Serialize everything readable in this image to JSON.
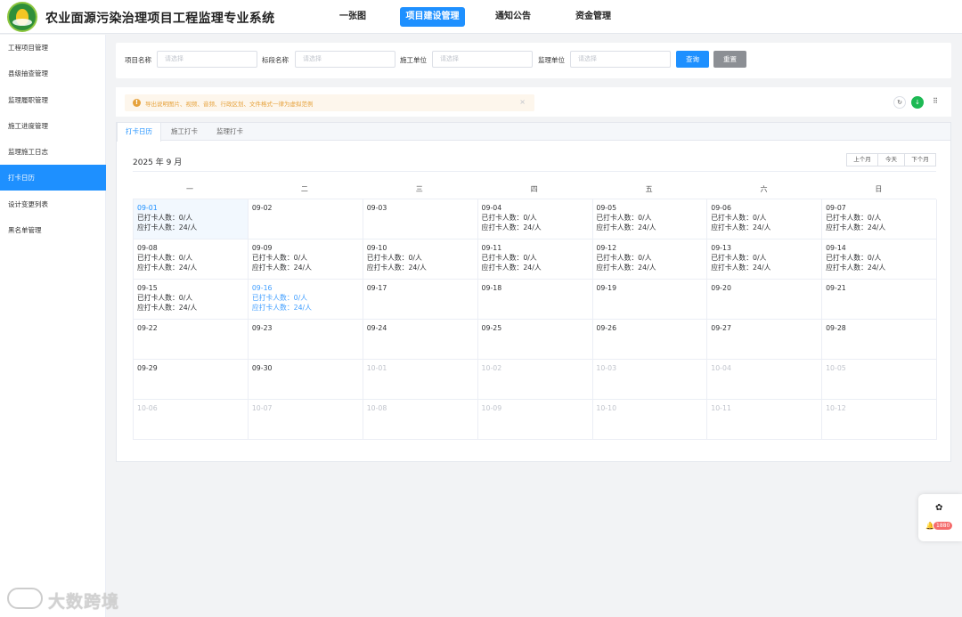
{
  "app": {
    "title": "农业面源污染治理项目工程监理专业系统"
  },
  "topnav": [
    {
      "label": "一张图",
      "active": false
    },
    {
      "label": "项目建设管理",
      "active": true
    },
    {
      "label": "通知公告",
      "active": false
    },
    {
      "label": "资金管理",
      "active": false
    }
  ],
  "sidebar": {
    "items": [
      {
        "label": "工程项目管理"
      },
      {
        "label": "县级抽查管理"
      },
      {
        "label": "监理履职管理"
      },
      {
        "label": "施工进度管理"
      },
      {
        "label": "监理施工日志"
      },
      {
        "label": "打卡日历",
        "active": true
      },
      {
        "label": "设计变更列表"
      },
      {
        "label": "黑名单管理"
      }
    ]
  },
  "filters": {
    "fields": [
      {
        "label": "项目名称",
        "placeholder": "请选择"
      },
      {
        "label": "标段名称",
        "placeholder": "请选择"
      },
      {
        "label": "施工单位",
        "placeholder": "请选择"
      },
      {
        "label": "监理单位",
        "placeholder": "请选择"
      }
    ],
    "query_label": "查询",
    "reset_label": "重置"
  },
  "alert": {
    "text": "导出说明图片、视频、音频、行政区划、文件格式一律为虚拟范例",
    "icon": "warning-icon"
  },
  "toolbar": {
    "icons": [
      "refresh-icon",
      "download-icon",
      "grid-icon"
    ]
  },
  "tabs": [
    {
      "label": "打卡日历",
      "active": true
    },
    {
      "label": "施工打卡",
      "active": false
    },
    {
      "label": "监理打卡",
      "active": false
    }
  ],
  "calendar": {
    "title": "2025 年 9 月",
    "nav": {
      "prev": "上个月",
      "today": "今天",
      "next": "下个月"
    },
    "weekdays": [
      "一",
      "二",
      "三",
      "四",
      "五",
      "六",
      "日"
    ],
    "checked_prefix": "已打卡人数：",
    "required_prefix": "应打卡人数：",
    "cells": [
      {
        "date": "09-01",
        "checked": "0/人",
        "required": "24/人",
        "state": "selected"
      },
      {
        "date": "09-02"
      },
      {
        "date": "09-03"
      },
      {
        "date": "09-04",
        "checked": "0/人",
        "required": "24/人"
      },
      {
        "date": "09-05",
        "checked": "0/人",
        "required": "24/人"
      },
      {
        "date": "09-06",
        "checked": "0/人",
        "required": "24/人"
      },
      {
        "date": "09-07",
        "checked": "0/人",
        "required": "24/人"
      },
      {
        "date": "09-08",
        "checked": "0/人",
        "required": "24/人"
      },
      {
        "date": "09-09",
        "checked": "0/人",
        "required": "24/人"
      },
      {
        "date": "09-10",
        "checked": "0/人",
        "required": "24/人"
      },
      {
        "date": "09-11",
        "checked": "0/人",
        "required": "24/人"
      },
      {
        "date": "09-12",
        "checked": "0/人",
        "required": "24/人"
      },
      {
        "date": "09-13",
        "checked": "0/人",
        "required": "24/人"
      },
      {
        "date": "09-14",
        "checked": "0/人",
        "required": "24/人"
      },
      {
        "date": "09-15",
        "checked": "0/人",
        "required": "24/人"
      },
      {
        "date": "09-16",
        "checked": "0/人",
        "required": "24/人",
        "state": "today"
      },
      {
        "date": "09-17"
      },
      {
        "date": "09-18"
      },
      {
        "date": "09-19"
      },
      {
        "date": "09-20"
      },
      {
        "date": "09-21"
      },
      {
        "date": "09-22"
      },
      {
        "date": "09-23"
      },
      {
        "date": "09-24"
      },
      {
        "date": "09-25"
      },
      {
        "date": "09-26"
      },
      {
        "date": "09-27"
      },
      {
        "date": "09-28"
      },
      {
        "date": "09-29"
      },
      {
        "date": "09-30"
      },
      {
        "date": "10-01",
        "state": "other"
      },
      {
        "date": "10-02",
        "state": "other"
      },
      {
        "date": "10-03",
        "state": "other"
      },
      {
        "date": "10-04",
        "state": "other"
      },
      {
        "date": "10-05",
        "state": "other"
      },
      {
        "date": "10-06",
        "state": "other"
      },
      {
        "date": "10-07",
        "state": "other"
      },
      {
        "date": "10-08",
        "state": "other"
      },
      {
        "date": "10-09",
        "state": "other"
      },
      {
        "date": "10-10",
        "state": "other"
      },
      {
        "date": "10-11",
        "state": "other"
      },
      {
        "date": "10-12",
        "state": "other"
      }
    ]
  },
  "float_panel": {
    "badge": "1880",
    "icons": [
      "gear-icon",
      "bell-icon"
    ]
  },
  "watermark": {
    "text": "大数跨境"
  },
  "colors": {
    "primary": "#1e90ff",
    "warning": "#e6a23c",
    "success": "#1db954",
    "danger": "#f56c6c"
  }
}
